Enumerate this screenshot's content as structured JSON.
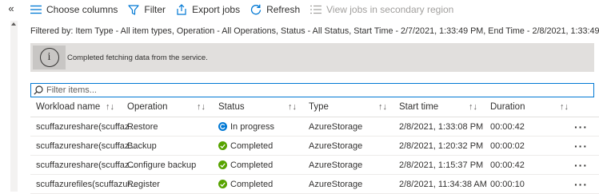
{
  "toolbar": {
    "choose_columns": "Choose columns",
    "filter": "Filter",
    "export_jobs": "Export jobs",
    "refresh": "Refresh",
    "view_secondary": "View jobs in secondary region"
  },
  "filter_summary": "Filtered by: Item Type - All item types, Operation - All Operations, Status - All Status, Start Time - 2/7/2021, 1:33:49 PM, End Time - 2/8/2021, 1:33:49 PM",
  "info_message": "Completed fetching data from the service.",
  "search": {
    "placeholder": "Filter items...",
    "value": ""
  },
  "columns": [
    "Workload name",
    "Operation",
    "Status",
    "Type",
    "Start time",
    "Duration"
  ],
  "rows": [
    {
      "workload": "scuffazureshare(scuffaz...",
      "operation": "Restore",
      "status": "In progress",
      "status_kind": "progress",
      "type": "AzureStorage",
      "start": "2/8/2021, 1:33:08 PM",
      "duration": "00:00:42"
    },
    {
      "workload": "scuffazureshare(scuffaz...",
      "operation": "Backup",
      "status": "Completed",
      "status_kind": "completed",
      "type": "AzureStorage",
      "start": "2/8/2021, 1:20:32 PM",
      "duration": "00:00:02"
    },
    {
      "workload": "scuffazureshare(scuffaz...",
      "operation": "Configure backup",
      "status": "Completed",
      "status_kind": "completed",
      "type": "AzureStorage",
      "start": "2/8/2021, 1:15:37 PM",
      "duration": "00:00:42"
    },
    {
      "workload": "scuffazurefiles(scuffazur...",
      "operation": "Register",
      "status": "Completed",
      "status_kind": "completed",
      "type": "AzureStorage",
      "start": "2/8/2021, 11:34:38 AM",
      "duration": "00:00:10"
    }
  ],
  "colors": {
    "accent": "#0078d4",
    "success": "#57a300",
    "info_bar": "#e1dfdd"
  }
}
